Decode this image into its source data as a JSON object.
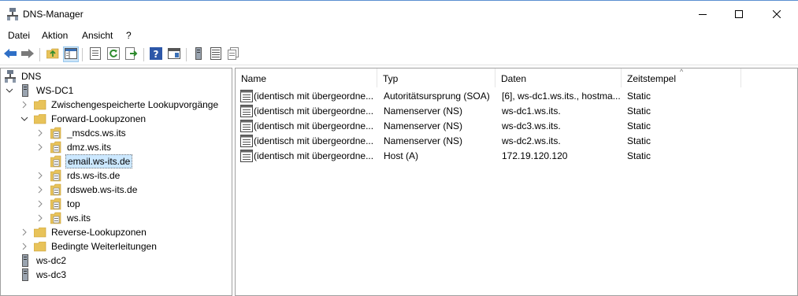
{
  "window": {
    "title": "DNS-Manager",
    "minimize_icon": "minimize-icon",
    "maximize_icon": "maximize-icon",
    "close_icon": "close-icon"
  },
  "menu": [
    "Datei",
    "Aktion",
    "Ansicht",
    "?"
  ],
  "toolbar": {
    "buttons": [
      "back-icon",
      "forward-icon",
      "up-folder-icon",
      "show-hide-tree-icon",
      "properties-icon",
      "refresh-icon",
      "export-list-icon",
      "help-icon",
      "mmc-view-icon",
      "server-icon",
      "records-icon",
      "copy-icon"
    ],
    "pressed": "show-hide-tree-icon"
  },
  "tree": {
    "root": "DNS",
    "server": "WS-DC1",
    "cached_lookups": "Zwischengespeicherte Lookupvorgänge",
    "forward_zones": "Forward-Lookupzonen",
    "zones": [
      "_msdcs.ws.its",
      "dmz.ws.its",
      "email.ws-its.de",
      "rds.ws-its.de",
      "rdsweb.ws-its.de",
      "top",
      "ws.its"
    ],
    "selected_zone": "email.ws-its.de",
    "reverse_zones": "Reverse-Lookupzonen",
    "conditional_forwarders": "Bedingte Weiterleitungen",
    "other_servers": [
      "ws-dc2",
      "ws-dc3"
    ]
  },
  "list": {
    "columns": [
      "Name",
      "Typ",
      "Daten",
      "Zeitstempel"
    ],
    "sort_indicator": "^",
    "rows": [
      {
        "name": "(identisch mit übergeordne...",
        "type": "Autoritätsursprung (SOA)",
        "data": "[6], ws-dc1.ws.its., hostma...",
        "timestamp": "Static"
      },
      {
        "name": "(identisch mit übergeordne...",
        "type": "Namenserver (NS)",
        "data": "ws-dc1.ws.its.",
        "timestamp": "Static"
      },
      {
        "name": "(identisch mit übergeordne...",
        "type": "Namenserver (NS)",
        "data": "ws-dc3.ws.its.",
        "timestamp": "Static"
      },
      {
        "name": "(identisch mit übergeordne...",
        "type": "Namenserver (NS)",
        "data": "ws-dc2.ws.its.",
        "timestamp": "Static"
      },
      {
        "name": "(identisch mit übergeordne...",
        "type": "Host (A)",
        "data": "172.19.120.120",
        "timestamp": "Static"
      }
    ]
  },
  "colors": {
    "folder": "#e8c35a",
    "selection": "#cce8ff",
    "toolbar_pressed": "#cce4f7",
    "arrow_blue": "#2f6fc6"
  }
}
